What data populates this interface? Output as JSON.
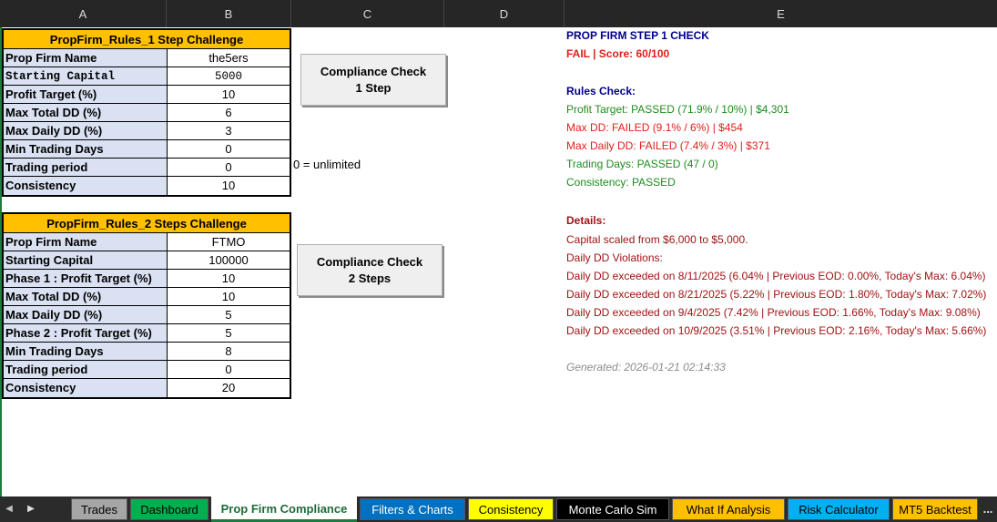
{
  "columns": [
    "A",
    "B",
    "C",
    "D",
    "E"
  ],
  "colors": {
    "rule_header": "#ffc000",
    "label_bg": "#d9e1f2",
    "pass": "#1e8c1e",
    "fail": "#e0201c",
    "heading": "#00008b",
    "detail": "#a01313",
    "generated": "#8c8c8c"
  },
  "table1": {
    "title": "PropFirm_Rules_1 Step Challenge",
    "rows": [
      {
        "label": "Prop Firm Name",
        "value": "the5ers"
      },
      {
        "label": "Starting Capital",
        "value": "5000"
      },
      {
        "label": "Profit Target (%)",
        "value": "10"
      },
      {
        "label": "Max Total DD (%)",
        "value": "6"
      },
      {
        "label": "Max Daily DD (%)",
        "value": "3"
      },
      {
        "label": "Min Trading Days",
        "value": "0"
      },
      {
        "label": "Trading period",
        "value": "0"
      },
      {
        "label": "Consistency",
        "value": "10"
      }
    ]
  },
  "table2": {
    "title": "PropFirm_Rules_2 Steps Challenge",
    "rows": [
      {
        "label": "Prop Firm Name",
        "value": "FTMO"
      },
      {
        "label": "Starting Capital",
        "value": "100000"
      },
      {
        "label": "Phase 1 : Profit Target (%)",
        "value": "10"
      },
      {
        "label": "Max Total DD (%)",
        "value": "10"
      },
      {
        "label": "Max Daily DD (%)",
        "value": "5"
      },
      {
        "label": "Phase 2 : Profit Target (%)",
        "value": "5"
      },
      {
        "label": "Min Trading Days",
        "value": "8"
      },
      {
        "label": "Trading period",
        "value": "0"
      },
      {
        "label": "Consistency",
        "value": "20"
      }
    ]
  },
  "buttons": {
    "check1": {
      "line1": "Compliance Check",
      "line2": "1 Step"
    },
    "check2": {
      "line1": "Compliance Check",
      "line2": "2 Steps"
    }
  },
  "note": "0 = unlimited",
  "report": {
    "title": "PROP FIRM STEP 1 CHECK",
    "result": "FAIL | Score: 60/100",
    "rules_heading": "Rules Check:",
    "rules": [
      {
        "text": "Profit Target: PASSED (71.9% / 10%) | $4,301",
        "status": "pass"
      },
      {
        "text": "Max DD: FAILED (9.1% / 6%) | $454",
        "status": "fail"
      },
      {
        "text": "Max Daily DD: FAILED (7.4% / 3%) | $371",
        "status": "fail"
      },
      {
        "text": "Trading Days: PASSED (47 / 0)",
        "status": "pass"
      },
      {
        "text": "Consistency: PASSED",
        "status": "pass"
      }
    ],
    "details_heading": "Details:",
    "details": [
      "Capital scaled from $6,000 to $5,000.",
      "Daily DD Violations:",
      "Daily DD exceeded on 8/11/2025 (6.04% | Previous EOD: 0.00%, Today's Max: 6.04%)",
      "Daily DD exceeded on 8/21/2025 (5.22% | Previous EOD: 1.80%, Today's Max: 7.02%)",
      "Daily DD exceeded on 9/4/2025 (7.42% | Previous EOD: 1.66%, Today's Max: 9.08%)",
      "Daily DD exceeded on 10/9/2025 (3.51% | Previous EOD: 2.16%, Today's Max: 5.66%)"
    ],
    "generated": "Generated: 2026-01-21 02:14:33"
  },
  "tabs": [
    {
      "label": "Trades",
      "bg": "#a6a6a6",
      "fg": "#000000",
      "active": false
    },
    {
      "label": "Dashboard",
      "bg": "#00b050",
      "fg": "#000000",
      "active": false
    },
    {
      "label": "Prop Firm Compliance",
      "bg": "#ffffff",
      "fg": "#1f6b3a",
      "active": true
    },
    {
      "label": "Filters & Charts",
      "bg": "#0070c0",
      "fg": "#ffffff",
      "active": false
    },
    {
      "label": "Consistency",
      "bg": "#ffff00",
      "fg": "#000000",
      "active": false
    },
    {
      "label": "Monte Carlo Sim",
      "bg": "#000000",
      "fg": "#ffffff",
      "active": false
    },
    {
      "label": "What If Analysis",
      "bg": "#ffc000",
      "fg": "#000000",
      "active": false
    },
    {
      "label": "Risk Calculator",
      "bg": "#00b0f0",
      "fg": "#000000",
      "active": false
    },
    {
      "label": "MT5 Backtest",
      "bg": "#ffc000",
      "fg": "#000000",
      "active": false
    }
  ],
  "tab_nav": {
    "prev": "◀",
    "next": "▶",
    "more": "..."
  }
}
